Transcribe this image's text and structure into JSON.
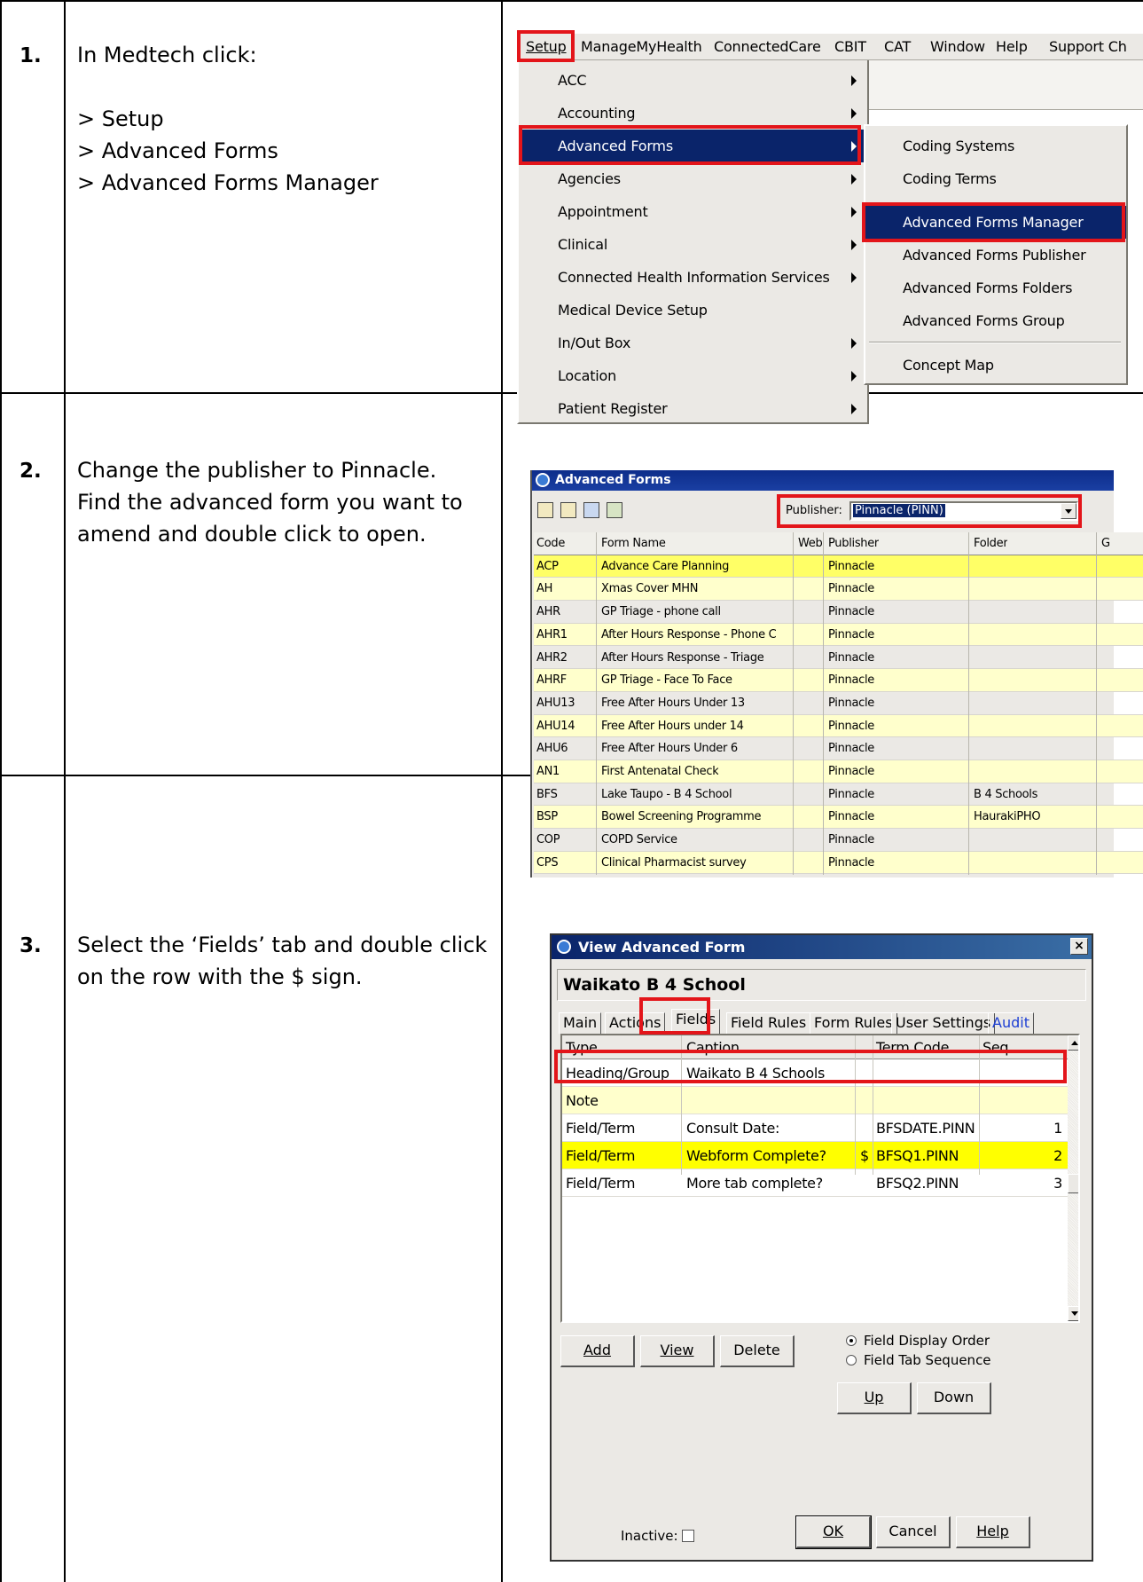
{
  "steps": [
    {
      "number": "1.",
      "lines": [
        "In Medtech click:",
        "",
        "> Setup",
        "> Advanced Forms",
        "> Advanced Forms Manager"
      ]
    },
    {
      "number": "2.",
      "lines": [
        "Change the publisher to Pinnacle.",
        "Find the advanced form you want to",
        "amend and double click to open."
      ]
    },
    {
      "number": "3.",
      "lines": [
        "Select the ‘Fields’ tab and double click",
        "on the row with the $ sign."
      ]
    }
  ],
  "menubar": [
    "Setup",
    "ManageMyHealth",
    "ConnectedCare",
    "CBIT",
    "CAT",
    "Window",
    "Help",
    "Support Ch"
  ],
  "setup_menu": [
    "ACC",
    "Accounting",
    "Advanced Forms",
    "Agencies",
    "Appointment",
    "Clinical",
    "Connected Health Information Services",
    "Medical Device Setup",
    "In/Out Box",
    "Location",
    "Patient Register"
  ],
  "advanced_forms_submenu": [
    "Coding Systems",
    "Coding Terms",
    "Advanced Forms Manager",
    "Advanced Forms Publisher",
    "Advanced Forms Folders",
    "Advanced Forms Group",
    "Concept Map"
  ],
  "advanced_forms_window": {
    "title": "Advanced Forms",
    "publisher_label": "Publisher:",
    "publisher_value": "Pinnacle (PINN)",
    "columns": [
      "Code",
      "Form Name",
      "Web",
      "Publisher",
      "Folder",
      "G"
    ],
    "rows": [
      [
        "ACP",
        "Advance Care Planning",
        "",
        "Pinnacle",
        ""
      ],
      [
        "AH",
        "Xmas Cover MHN",
        "",
        "Pinnacle",
        ""
      ],
      [
        "AHR",
        "GP Triage - phone call",
        "",
        "Pinnacle",
        ""
      ],
      [
        "AHR1",
        "After Hours Response - Phone C",
        "",
        "Pinnacle",
        ""
      ],
      [
        "AHR2",
        "After Hours Response - Triage",
        "",
        "Pinnacle",
        ""
      ],
      [
        "AHRF",
        "GP Triage - Face To Face",
        "",
        "Pinnacle",
        ""
      ],
      [
        "AHU13",
        "Free After Hours Under 13",
        "",
        "Pinnacle",
        ""
      ],
      [
        "AHU14",
        "Free After Hours under 14",
        "",
        "Pinnacle",
        ""
      ],
      [
        "AHU6",
        "Free After Hours Under 6",
        "",
        "Pinnacle",
        ""
      ],
      [
        "AN1",
        "First Antenatal Check",
        "",
        "Pinnacle",
        ""
      ],
      [
        "BFS",
        "Lake Taupo - B 4 School",
        "",
        "Pinnacle",
        "B 4 Schools"
      ],
      [
        "BSP",
        "Bowel Screening Programme",
        "",
        "Pinnacle",
        "HaurakiPHO"
      ],
      [
        "COP",
        "COPD Service",
        "",
        "Pinnacle",
        ""
      ],
      [
        "CPS",
        "Clinical Pharmacist survey",
        "",
        "Pinnacle",
        ""
      ]
    ]
  },
  "view_form_dialog": {
    "title": "View Advanced Form",
    "form_name": "Waikato B 4 School",
    "tabs": [
      "Main",
      "Actions",
      "Fields",
      "Field Rules",
      "Form Rules",
      "User Settings",
      "Audit"
    ],
    "columns": [
      "Type",
      "Caption",
      "",
      "Term Code",
      "Seq"
    ],
    "rows": [
      [
        "Heading/Group",
        "Waikato B 4 Schools",
        "",
        "",
        ""
      ],
      [
        "Note",
        "",
        "",
        "",
        ""
      ],
      [
        "Field/Term",
        "Consult Date:",
        "",
        "BFSDATE.PINN",
        "1"
      ],
      [
        "Field/Term",
        "Webform Complete?",
        "$",
        "BFSQ1.PINN",
        "2"
      ],
      [
        "Field/Term",
        "More tab complete?",
        "",
        "BFSQ2.PINN",
        "3"
      ]
    ],
    "buttons": {
      "add": "Add",
      "view": "View",
      "delete": "Delete",
      "up": "Up",
      "down": "Down",
      "ok": "OK",
      "cancel": "Cancel",
      "help": "Help"
    },
    "radio_display_order": "Field Display Order",
    "radio_tab_sequence": "Field Tab Sequence",
    "inactive_label": "Inactive:"
  }
}
